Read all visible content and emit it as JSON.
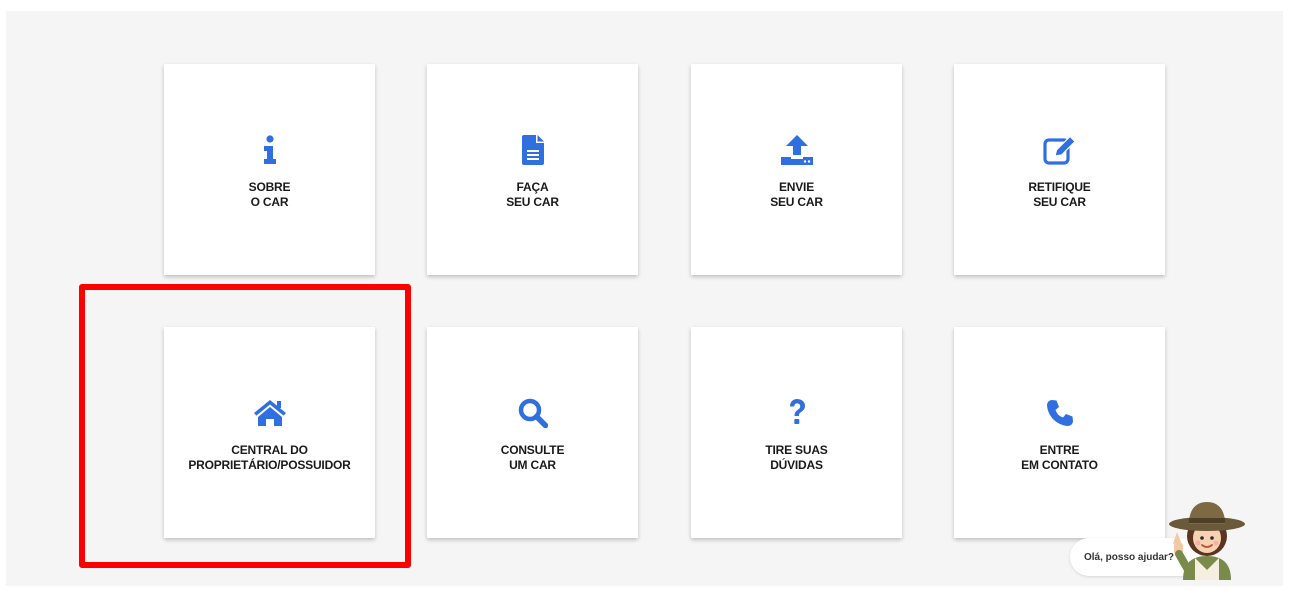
{
  "brand_color": "#2f6fe0",
  "cards": [
    {
      "id": "sobre",
      "icon": "info-icon",
      "lines": [
        "SOBRE",
        "O CAR"
      ]
    },
    {
      "id": "faca",
      "icon": "document-icon",
      "lines": [
        "FAÇA",
        "SEU CAR"
      ]
    },
    {
      "id": "envie",
      "icon": "upload-icon",
      "lines": [
        "ENVIE",
        "SEU CAR"
      ]
    },
    {
      "id": "retifique",
      "icon": "edit-icon",
      "lines": [
        "RETIFIQUE",
        "SEU CAR"
      ]
    },
    {
      "id": "central",
      "icon": "home-icon",
      "lines": [
        "CENTRAL DO",
        "PROPRIETÁRIO/POSSUIDOR"
      ]
    },
    {
      "id": "consulte",
      "icon": "search-icon",
      "lines": [
        "CONSULTE",
        "UM CAR"
      ]
    },
    {
      "id": "duvidas",
      "icon": "question-icon",
      "lines": [
        "TIRE SUAS",
        "DÚVIDAS"
      ]
    },
    {
      "id": "contato",
      "icon": "phone-icon",
      "lines": [
        "ENTRE",
        "EM CONTATO"
      ]
    }
  ],
  "assistant": {
    "message": "Olá, posso ajudar?",
    "avatar": "assistant-avatar-icon"
  }
}
